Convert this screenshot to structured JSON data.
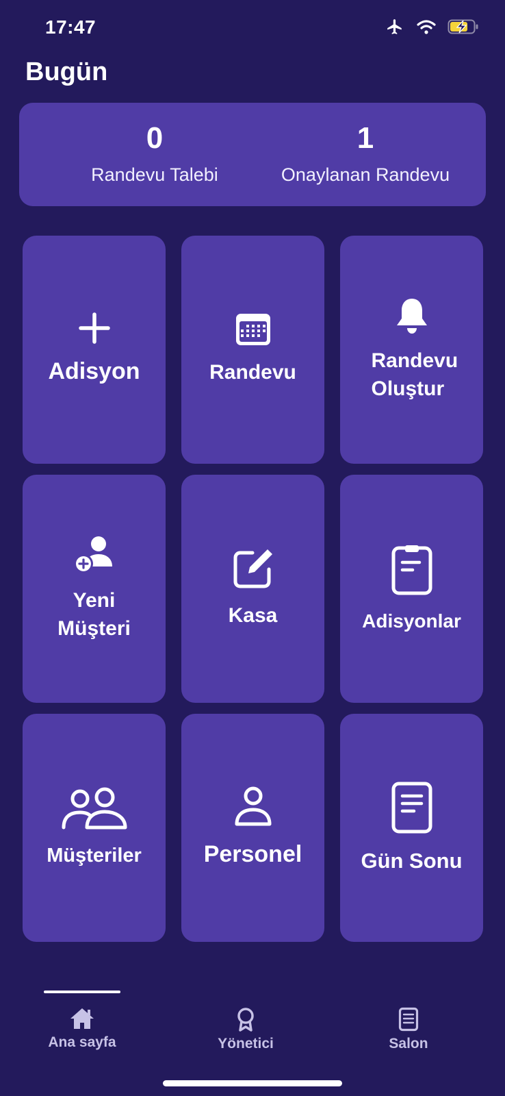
{
  "status": {
    "time": "17:47"
  },
  "title": "Bugün",
  "summary": {
    "requests": {
      "value": "0",
      "label": "Randevu Talebi"
    },
    "approved": {
      "value": "1",
      "label": "Onaylanan Randevu"
    }
  },
  "tiles": [
    {
      "label": "Adisyon",
      "icon": "plus-icon"
    },
    {
      "label": "Randevu",
      "icon": "calendar-icon"
    },
    {
      "label": "Randevu Oluştur",
      "icon": "bell-icon"
    },
    {
      "label": "Yeni Müşteri",
      "icon": "add-person-icon"
    },
    {
      "label": "Kasa",
      "icon": "edit-icon"
    },
    {
      "label": "Adisyonlar",
      "icon": "clipboard-icon"
    },
    {
      "label": "Müşteriler",
      "icon": "people-icon"
    },
    {
      "label": "Personel",
      "icon": "person-icon"
    },
    {
      "label": "Gün Sonu",
      "icon": "document-icon"
    }
  ],
  "tabs": [
    {
      "label": "Ana sayfa",
      "icon": "home-icon"
    },
    {
      "label": "Yönetici",
      "icon": "badge-icon"
    },
    {
      "label": "Salon",
      "icon": "list-icon"
    }
  ],
  "colors": {
    "background": "#231a5c",
    "card": "#503ca6",
    "battery": "#f5d33a"
  }
}
